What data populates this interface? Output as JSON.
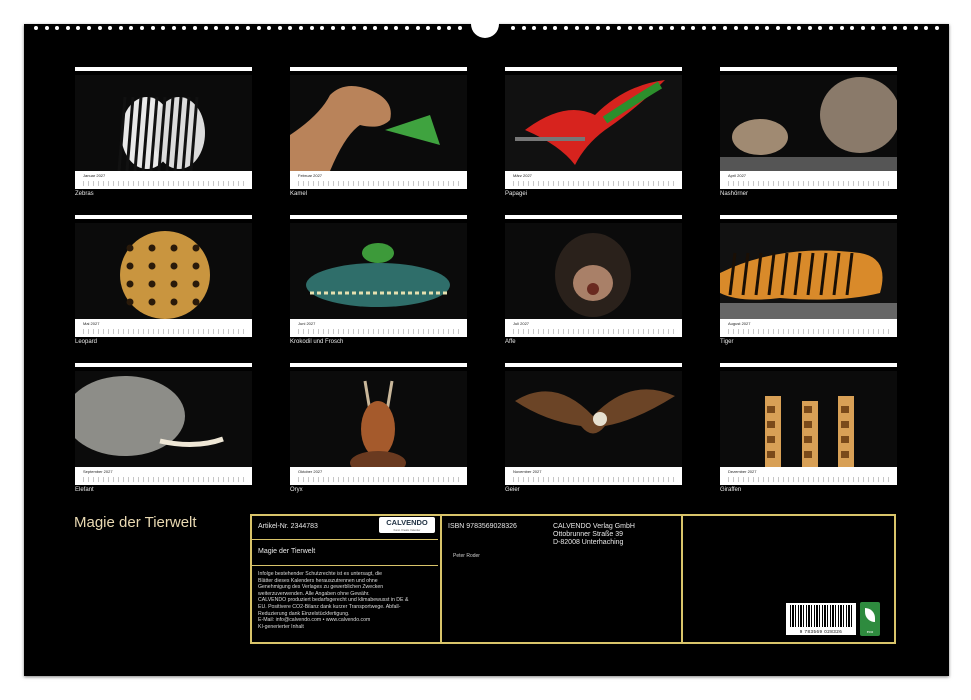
{
  "title": "Magie der Tierwelt",
  "months": [
    {
      "month": "Januar 2027",
      "caption": "Zebras",
      "icon": "zebra-photo"
    },
    {
      "month": "Februar 2027",
      "caption": "Kamel",
      "icon": "camel-photo"
    },
    {
      "month": "März 2027",
      "caption": "Papagei",
      "icon": "parrot-photo"
    },
    {
      "month": "April 2027",
      "caption": "Nashörner",
      "icon": "rhino-photo"
    },
    {
      "month": "Mai 2027",
      "caption": "Leopard",
      "icon": "leopard-photo"
    },
    {
      "month": "Juni 2027",
      "caption": "Krokodil und Frosch",
      "icon": "crocodile-frog-photo"
    },
    {
      "month": "Juli 2027",
      "caption": "Affe",
      "icon": "chimpanzee-photo"
    },
    {
      "month": "August 2027",
      "caption": "Tiger",
      "icon": "tiger-photo"
    },
    {
      "month": "September 2027",
      "caption": "Elefant",
      "icon": "elephant-photo"
    },
    {
      "month": "Oktober 2027",
      "caption": "Oryx",
      "icon": "antelope-photo"
    },
    {
      "month": "November 2027",
      "caption": "Geier",
      "icon": "vulture-photo"
    },
    {
      "month": "Dezember 2027",
      "caption": "Giraffen",
      "icon": "giraffe-photo"
    }
  ],
  "info": {
    "article": "Artikel-Nr. 2344783",
    "logo": "CALVENDO",
    "logo_sub": "Kunst. Kreativ. Kalender",
    "product_title": "Magie der Tierwelt",
    "isbn": "ISBN 9783569028326",
    "publisher": [
      "CALVENDO Verlag GmbH",
      "Ottobrunner Straße 39",
      "D-82008 Unterhaching"
    ],
    "author": "Peter Roder",
    "legal": [
      "Infolge bestehender Schutzrechte ist es untersagt, die",
      "Blätter dieses Kalenders herauszutrennen und ohne",
      "Genehmigung des Verlages zu gewerblichen Zwecken",
      "weiterzuverwenden. Alle Angaben ohne Gewähr.",
      "CALVENDO produziert bedarfsgerecht und klimabewusst in DE &",
      "EU. Positivere CO2-Bilanz dank kurzer Transportwege. Abfall-",
      "Reduzierung dank Einzelstückfertigung.",
      "E-Mail: info@calvendo.com • www.calvendo.com",
      "KI-generierter Inhalt"
    ],
    "barcode_number": "9 783569 028326",
    "eco_label": "eco"
  },
  "colors": {
    "sheet": "#000000",
    "frame": "#d9c46a",
    "title": "#e9d9b2"
  }
}
